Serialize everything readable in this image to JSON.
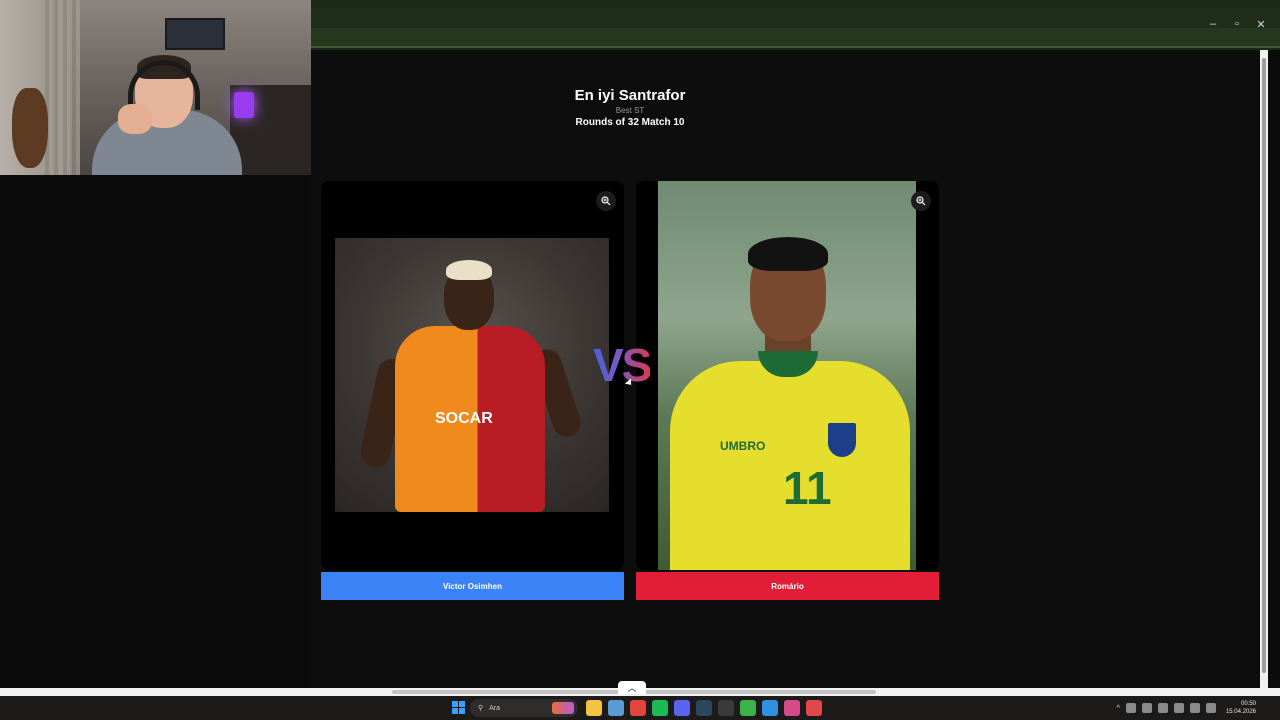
{
  "game": {
    "title": "En iyi Santrafor",
    "subtitle": "Best ST",
    "round": "Rounds of 32 Match 10",
    "vs": "VS"
  },
  "left_player": {
    "name": "Victor Osimhen",
    "button_color": "#3b82f6",
    "shirt_sponsor": "SOCAR"
  },
  "right_player": {
    "name": "Romário",
    "button_color": "#e11d38",
    "shirt_number": "11",
    "shirt_brand": "UMBRO"
  },
  "browser": {
    "controls": [
      "–",
      "▫",
      "✕"
    ]
  },
  "taskbar": {
    "search_placeholder": "Ara",
    "time": "00:50",
    "date": "15.04.2026",
    "apps": [
      {
        "name": "file-explorer-icon",
        "color": "#f3c241"
      },
      {
        "name": "store-icon",
        "color": "#5b9bd5"
      },
      {
        "name": "chrome-icon",
        "color": "#e2463a"
      },
      {
        "name": "spotify-icon",
        "color": "#1db954"
      },
      {
        "name": "discord-icon",
        "color": "#5865f2"
      },
      {
        "name": "steam-icon",
        "color": "#2a475e"
      },
      {
        "name": "epic-games-icon",
        "color": "#3a3a3a"
      },
      {
        "name": "play-icon",
        "color": "#3bb34a"
      },
      {
        "name": "vscode-icon",
        "color": "#2f8fe0"
      },
      {
        "name": "browser-icon",
        "color": "#d64a8a"
      },
      {
        "name": "app-icon",
        "color": "#e04848"
      }
    ]
  }
}
